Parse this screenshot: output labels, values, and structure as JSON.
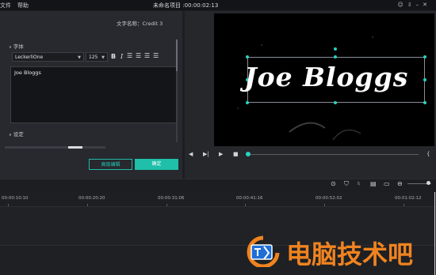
{
  "menu": [
    "文件",
    "帮助"
  ],
  "window_title": "未命名项目 :00:00:02:13",
  "top_icons": [
    "user-icon",
    "download-icon",
    "minimize-icon",
    "close-icon"
  ],
  "editor": {
    "name_label": "文字名称：Credit 3",
    "font_section": "字体",
    "font_family": "LeckerliOne",
    "font_size": "125",
    "bold": "B",
    "italic": "I",
    "text_value": "Joe Bloggs",
    "settings_section": "设定",
    "advanced_button": "高级编辑",
    "ok_button": "确定"
  },
  "preview": {
    "text": "Joe Bloggs"
  },
  "timeline": {
    "ticks": [
      "00:00:10:10",
      "00:00:20:20",
      "00:00:31:06",
      "00:00:41:16",
      "00:00:52:02",
      "00:01:02:12"
    ]
  },
  "watermark": {
    "text": "电脑技术吧"
  },
  "colors": {
    "accent": "#1fbfa9",
    "watermark": "#f0831f"
  }
}
